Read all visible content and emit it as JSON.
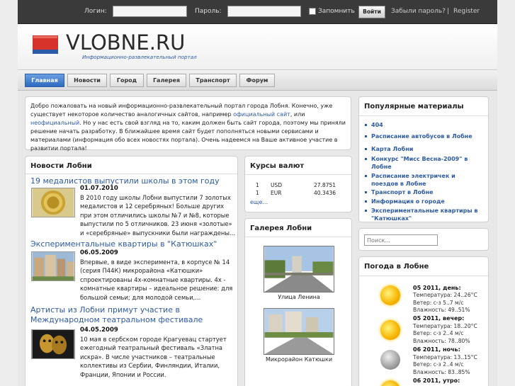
{
  "topbar": {
    "login_label": "Логин:",
    "password_label": "Пароль:",
    "remember_label": "Запомнить",
    "submit_label": "Войти",
    "forgot_label": "Забыли пароль?",
    "separator": "|",
    "register_label": "Register"
  },
  "header": {
    "logo_text": "VLOBNE.RU",
    "logo_subtitle": "Информационно-развлекательный портал"
  },
  "nav": {
    "tabs": [
      {
        "label": "Главная"
      },
      {
        "label": "Новости"
      },
      {
        "label": "Город"
      },
      {
        "label": "Галерея"
      },
      {
        "label": "Транспорт"
      },
      {
        "label": "Форум"
      }
    ]
  },
  "welcome": {
    "text_1": "Добро пожаловать на новый информационно-развлекательный портал города Лобня. Конечно, уже существует некоторое количество аналогичных сайтов, например ",
    "link_1": "официальный сайт",
    "text_2": ", или ",
    "link_2": "неофициальный",
    "text_3": ". Но у нас есть свой взгляд на то, каким должен быть сайт города, поэтому мы приняли решение начать разработку. В ближайшее время сайт будет пополняться новыми сервисами и материалами (информация обо всех новостях портала).  Очень надеемся на Ваше активное участие в развитии портала!"
  },
  "news": {
    "title": "Новости Лобни",
    "items": [
      {
        "title": "19 медалистов выпустили школы в этом году",
        "date": "01.07.2010",
        "text": "В 2010 году школы Лобни выпустили 7 золотых медалистов и 12 серебряных! Больше других при этом отличились школы №7 и №8, которые выпустили по 5 отличников. 23 июня «золотые» и «серебряные» выпускники были награждены..."
      },
      {
        "title": "Экспериментальные квартиры в \"Катюшках\"",
        "date": "06.05.2009",
        "text": "Впервые, в виде эксперимента, в корпусе № 14 (серия П44К) микрорайона «Катюшки» спроектированы 4х-комнатные квартиры. 4х - комнатные квартиры – идеальное решение: для большой семьи; для молодой семьи,..."
      },
      {
        "title": "Артисты из Лобни примут участие в Международном театральном фестивале",
        "date": "04.05.2009",
        "text": "10 мая в сербском городе Крагуевац стартует ежегодный театральный фестиваль «Златна искра». В числе участников – театральные коллективы из Сербии, Финляндии, Италии, Франции, Японии и России."
      }
    ]
  },
  "currency": {
    "title": "Курсы валют",
    "rows": [
      {
        "qty": "1",
        "code": "USD",
        "rate": "27.8751"
      },
      {
        "qty": "1",
        "code": "EUR",
        "rate": "40.3436"
      }
    ],
    "more_label": "еще..."
  },
  "gallery": {
    "title": "Галерея Лобни",
    "items": [
      {
        "caption": "Улица Ленина"
      },
      {
        "caption": "Микрорайон Катюшки"
      }
    ]
  },
  "popular": {
    "title": "Популярные материалы",
    "items": [
      "404",
      "Расписание автобусов в Лобне",
      "Карта Лобни",
      "Конкурс \"Мисс Весна-2009\" в Лобне",
      "Расписание электричек и поездов в Лобне",
      "Транспорт в Лобне",
      "Информация о городе",
      "Экспериментальные квартиры в \"Катюшках\""
    ]
  },
  "search": {
    "placeholder": "Поиск..."
  },
  "weather": {
    "title": "Погода в Лобне",
    "entries": [
      {
        "icon": "sun-icon",
        "head": "05 2011, день:",
        "temp": "Температура: 24..26°C",
        "wind": "Ветер: с-з 5..7 м/с",
        "humidity": "Влажность: 49..51%"
      },
      {
        "icon": "sun-icon",
        "head": "05 2011, вечер:",
        "temp": "Температура: 18..20°C",
        "wind": "Ветер: с-з 2..4 м/с",
        "humidity": "Влажность: 78..80%"
      },
      {
        "icon": "moon-icon",
        "head": "06 2011, ночь:",
        "temp": "Температура: 13..15°C",
        "wind": "Ветер: с-з 2..4 м/с",
        "humidity": "Влажность: 83..85%"
      },
      {
        "icon": "sun-icon",
        "head": "06 2011, утро:",
        "temp": "",
        "wind": "",
        "humidity": ""
      }
    ]
  },
  "colors": {
    "link": "#2d5aa6",
    "active_tab": "#3b78cf",
    "topbar": "#3a3a3a"
  }
}
